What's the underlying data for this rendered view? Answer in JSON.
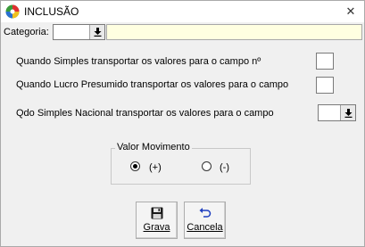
{
  "window": {
    "title": "INCLUSÃO",
    "close_glyph": "✕",
    "app_icon": "colorful-circle-icon"
  },
  "form": {
    "categoria_label": "Categoria:",
    "categoria_value": "",
    "categoria_desc": "",
    "simples_label": "Quando Simples transportar os valores para o campo nº",
    "simples_value": "",
    "lucro_label": "Quando Lucro Presumido transportar os valores para o campo",
    "lucro_value": "",
    "nacional_label": "Qdo Simples Nacional transportar os valores para o campo",
    "nacional_value": ""
  },
  "valor_movimento": {
    "title": "Valor Movimento",
    "options": [
      {
        "label": "(+)",
        "checked": true
      },
      {
        "label": "(-)",
        "checked": false
      }
    ]
  },
  "buttons": {
    "grava_label": "Grava",
    "cancela_label": "Cancela"
  },
  "colors": {
    "desc_field_bg": "#ffffe1",
    "window_bg": "#f0f0f0"
  }
}
